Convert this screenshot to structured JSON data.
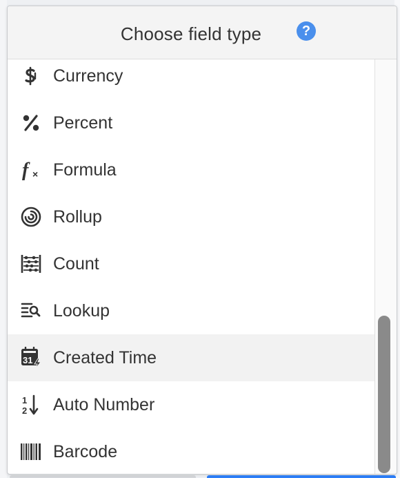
{
  "header": {
    "title": "Choose field type",
    "help_glyph": "?"
  },
  "colors": {
    "help_icon": "#4a8fec",
    "highlight_row": "#f2f2f2",
    "icon": "#333333"
  },
  "field_types": [
    {
      "label": "Currency",
      "icon": "currency-icon"
    },
    {
      "label": "Percent",
      "icon": "percent-icon"
    },
    {
      "label": "Formula",
      "icon": "formula-icon"
    },
    {
      "label": "Rollup",
      "icon": "rollup-icon"
    },
    {
      "label": "Count",
      "icon": "count-icon"
    },
    {
      "label": "Lookup",
      "icon": "lookup-icon"
    },
    {
      "label": "Created Time",
      "icon": "created-time-icon",
      "highlighted": true
    },
    {
      "label": "Auto Number",
      "icon": "auto-number-icon"
    },
    {
      "label": "Barcode",
      "icon": "barcode-icon"
    }
  ],
  "icon_text": {
    "formula_f": "f",
    "formula_x": "×",
    "calendar_day": "31",
    "auto_number_1": "1",
    "auto_number_2": "2"
  }
}
